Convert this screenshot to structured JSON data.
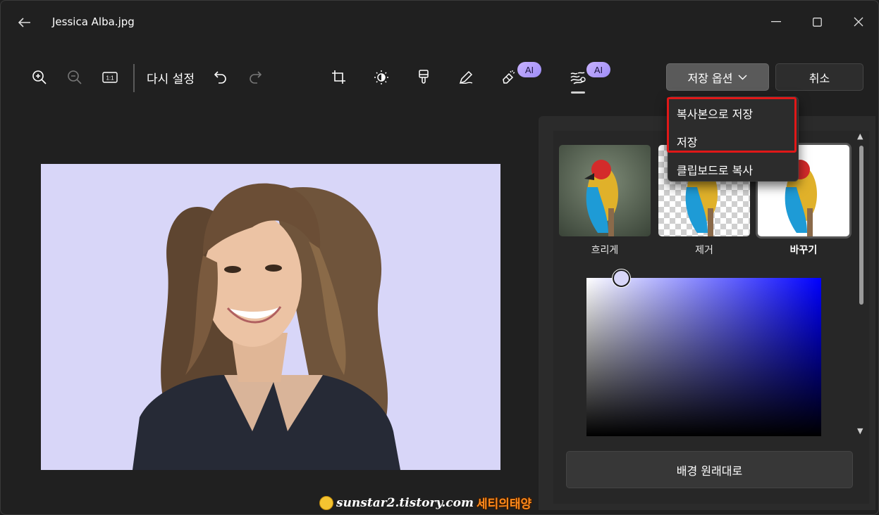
{
  "window": {
    "title": "Jessica Alba.jpg"
  },
  "toolbar": {
    "reset_label": "다시 설정",
    "zoom_fit_label": "1:1",
    "ai_badge_1": "AI",
    "ai_badge_2": "AI",
    "save_options_label": "저장 옵션",
    "cancel_label": "취소"
  },
  "menu": {
    "items": [
      "복사본으로 저장",
      "저장",
      "클립보드로 복사"
    ]
  },
  "background_panel": {
    "options": [
      {
        "label": "흐리게",
        "selected": false
      },
      {
        "label": "제거",
        "selected": false
      },
      {
        "label": "바꾸기",
        "selected": true
      }
    ],
    "selected_color": "#d8d6f8",
    "hue_color": "#0000ff",
    "restore_label": "배경 원래대로"
  },
  "watermark": {
    "site": "sunstar2.tistory.com",
    "name": "세티의태양"
  },
  "colors": {
    "background": "#202020",
    "highlight": "#e01818",
    "ai_badge": "#b9a4ff"
  }
}
